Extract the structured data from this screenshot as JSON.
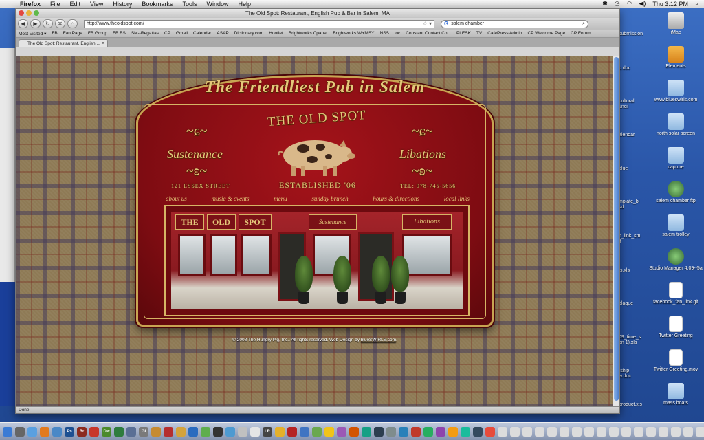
{
  "menubar": {
    "app_name": "Firefox",
    "menus": [
      "File",
      "Edit",
      "View",
      "History",
      "Bookmarks",
      "Tools",
      "Window",
      "Help"
    ],
    "clock": "Thu 3:12 PM"
  },
  "browser": {
    "window_title": "The Old Spot: Restaurant, English Pub & Bar in Salem, MA",
    "url": "http://www.theoldspot.com/",
    "search_query": "salem chamber",
    "bookmarks": [
      "Most Visited ▾",
      "FB",
      "Fan Page",
      "FB Group",
      "FB BS",
      "SM--Regattas",
      "CP",
      "Gmail",
      "Calendar",
      "ASAP",
      "Dictionary.com",
      "Hootlet",
      "Brightworks Cpanel",
      "Brightworks WYMSY",
      "NSS",
      "loc",
      "Constant Contact Co...",
      "PLESK",
      "TV",
      "CafePress Admin",
      "CP Welcome Page",
      "CP Forum"
    ],
    "tab_title": "The Old Spot: Restaurant, English ...",
    "status": "Done"
  },
  "sign": {
    "tagline": "The Friendliest Pub in Salem",
    "brand": "THE OLD SPOT",
    "left_word": "Sustenance",
    "right_word": "Libations",
    "address": "121 ESSEX STREET",
    "established": "ESTABLISHED '06",
    "phone": "TEL: 978-745-5656",
    "nav": [
      "about us",
      "music & events",
      "menu",
      "sunday brunch",
      "hours & directions",
      "local links"
    ],
    "photo_sign": {
      "the": "THE",
      "old": "OLD",
      "spot": "SPOT",
      "sustenance": "Sustenance",
      "libations": "Libations"
    }
  },
  "footer": {
    "text": "© 2008 The Hungry Pig, Inc.. All rights reserved. Web Design by ",
    "link": "blueSWIRLS.com",
    "suffix": "."
  },
  "desktop": {
    "icons": [
      {
        "label": "iMac",
        "type": "drive"
      },
      {
        "label": "Elements",
        "type": "usb"
      },
      {
        "label": "www.blueswirls.com",
        "type": "folder"
      },
      {
        "label": "north solar screen",
        "type": "folder"
      },
      {
        "label": "capture",
        "type": "folder"
      },
      {
        "label": "salem chamber ftp",
        "type": "app"
      },
      {
        "label": "salem trolley",
        "type": "folder"
      },
      {
        "label": "Studio Manager 4.09--5a",
        "type": "app"
      },
      {
        "label": "facebook_fan_link.gif",
        "type": "doc"
      },
      {
        "label": "Twitter Greeting",
        "type": "doc"
      },
      {
        "label": "Twitter Greeting.mov",
        "type": "doc"
      },
      {
        "label": "mass boats",
        "type": "folder"
      }
    ],
    "partial_labels": [
      "submission",
      "p.doc",
      "cultural",
      "uncil",
      "alendar",
      "blue",
      "mplate_bl",
      "sd",
      "n_link_sm",
      "lf",
      "ts.xls",
      "plaque",
      "09_time_s",
      "on 1).xls",
      "rship",
      "w.doc",
      "product.xls"
    ]
  },
  "colors": {
    "sign_red": "#8b0f15",
    "gold": "#e4c77a",
    "desktop_blue": "#2a56a8"
  }
}
